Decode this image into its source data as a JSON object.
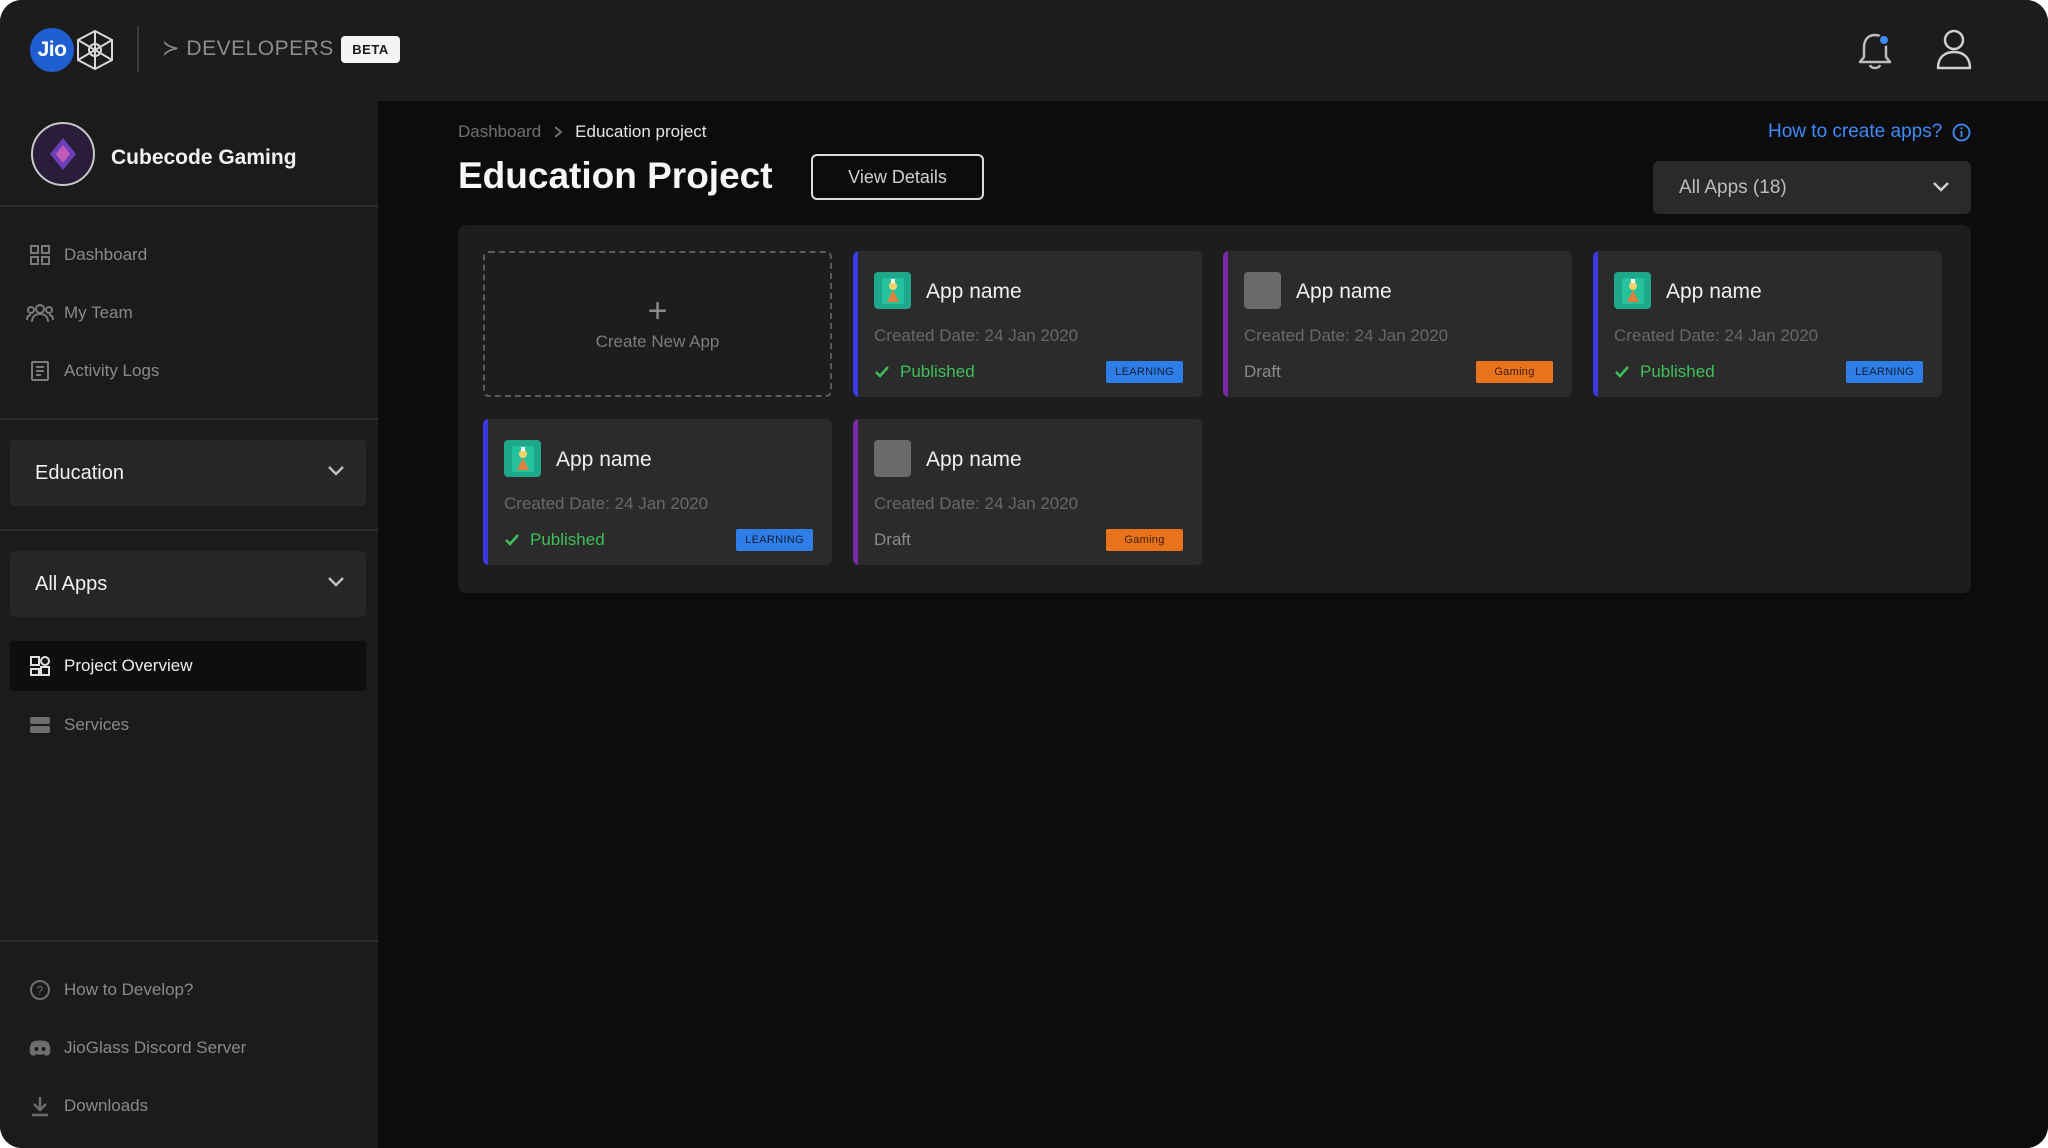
{
  "header": {
    "brand": "Jio",
    "section_label": "≻ DEVELOPERS",
    "beta_badge": "BETA",
    "icons": [
      "notification-bell-icon",
      "user-profile-icon"
    ]
  },
  "sidebar": {
    "org_name": "Cubecode Gaming",
    "nav_top": [
      {
        "label": "Dashboard",
        "icon": "grid-icon"
      },
      {
        "label": "My Team",
        "icon": "team-icon"
      },
      {
        "label": "Activity Logs",
        "icon": "activity-log-icon"
      }
    ],
    "project_select": "Education",
    "apps_select": "All Apps",
    "nav_project": [
      {
        "label": "Project Overview",
        "icon": "overview-icon",
        "active": true
      },
      {
        "label": "Services",
        "icon": "services-icon",
        "active": false
      }
    ],
    "nav_bottom": [
      {
        "label": "How to Develop?",
        "icon": "help-circle-icon"
      },
      {
        "label": "JioGlass Discord Server",
        "icon": "discord-icon"
      },
      {
        "label": "Downloads",
        "icon": "download-icon"
      }
    ]
  },
  "main": {
    "breadcrumb": [
      "Dashboard",
      "Education project"
    ],
    "title": "Education Project",
    "view_details_label": "View Details",
    "help_link": "How to create apps?",
    "filter_value": "All Apps (18)",
    "create_label": "Create New App",
    "apps": [
      {
        "name": "App name",
        "created": "Created Date: 24 Jan 2020",
        "status": "Published",
        "tag": "LEARNING",
        "accent": "#3a3ae0",
        "icon_type": "app-game-icon"
      },
      {
        "name": "App name",
        "created": "Created Date: 24 Jan 2020",
        "status": "Draft",
        "tag": "Gaming",
        "accent": "#7a2aa8",
        "icon_type": "placeholder-icon"
      },
      {
        "name": "App name",
        "created": "Created Date: 24 Jan 2020",
        "status": "Published",
        "tag": "LEARNING",
        "accent": "#3a3ae0",
        "icon_type": "app-game-icon"
      },
      {
        "name": "App name",
        "created": "Created Date: 24 Jan 2020",
        "status": "Published",
        "tag": "LEARNING",
        "accent": "#3a3ae0",
        "icon_type": "app-game-icon"
      },
      {
        "name": "App name",
        "created": "Created Date: 24 Jan 2020",
        "status": "Draft",
        "tag": "Gaming",
        "accent": "#7a2aa8",
        "icon_type": "placeholder-icon"
      }
    ]
  },
  "colors": {
    "link_blue": "#3d8cf7",
    "published_green": "#3fbf5a",
    "learning_tag": "#2f7ee8",
    "gaming_tag": "#e8731b",
    "published_accent": "#3a3ae0",
    "draft_accent": "#7a2aa8"
  }
}
